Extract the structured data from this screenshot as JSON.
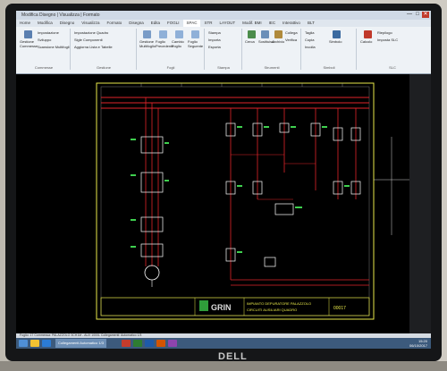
{
  "brand": "DELL",
  "window": {
    "title": "Modifica Disegno | Visualizza | Formato",
    "controls": [
      "—",
      "□",
      "✕"
    ]
  },
  "menu_tabs": [
    "Home",
    "Modifica",
    "Disegno",
    "Visualizza",
    "Formato",
    "Disegna",
    "Edita",
    "FOGLI",
    "SPAC",
    "STR",
    "LAYOUT",
    "Modif. BMI",
    "IEC",
    "Interattivo",
    "BLT"
  ],
  "ribbon": {
    "groups": [
      {
        "label": "Commesse",
        "buttons": [
          "Gestione Commesse",
          "Impostazione",
          "Sviluppo",
          "Scansione Multifogli"
        ]
      },
      {
        "label": "Gestione",
        "buttons": [
          "Impostazione Quadro",
          "Sigle Componenti",
          "Aggiorna Lista e Tabelle"
        ]
      },
      {
        "label": "Fogli",
        "buttons": [
          "Gestione Multifoglio",
          "Foglio Precedente",
          "Cambio Foglio",
          "Foglio Seguente"
        ]
      },
      {
        "label": "Stampa",
        "buttons": [
          "Stampa",
          "Importa",
          "Esporta"
        ]
      },
      {
        "label": "Strumenti",
        "buttons": [
          "Cerca",
          "Sostituisci",
          "Archivio",
          "Collega",
          "Verifica"
        ]
      },
      {
        "label": "Simboli",
        "buttons": [
          "Taglia",
          "Copia",
          "Incolla",
          "Simbolo"
        ]
      },
      {
        "label": "SLC",
        "buttons": [
          "Calcolo",
          "Riepilogo",
          "Imposta SLC"
        ]
      }
    ]
  },
  "drawing": {
    "title_block": {
      "company": "GRIN",
      "description_1": "IMPIANTO DEPURATORE PALAZZOLO",
      "description_2": "CIRCUITI AUSILIARI QUADRO",
      "sheet": "00017"
    }
  },
  "status_bar": "Foglio: 17  Commessa: PALAZZOLO 3CH1M - AUX 1000L   Collegamenti: Automatico 1/3",
  "taskbar": {
    "active_label": "Collegamenti Automatico 1/3",
    "time": "15:20",
    "date": "06/10/2017"
  },
  "colors": {
    "canvas": "#000000",
    "wire_power": "#e0242a",
    "wire_aux": "#e0242a",
    "frame": "#e8e84a",
    "component": "#ffffff",
    "label": "#3fd04f"
  }
}
